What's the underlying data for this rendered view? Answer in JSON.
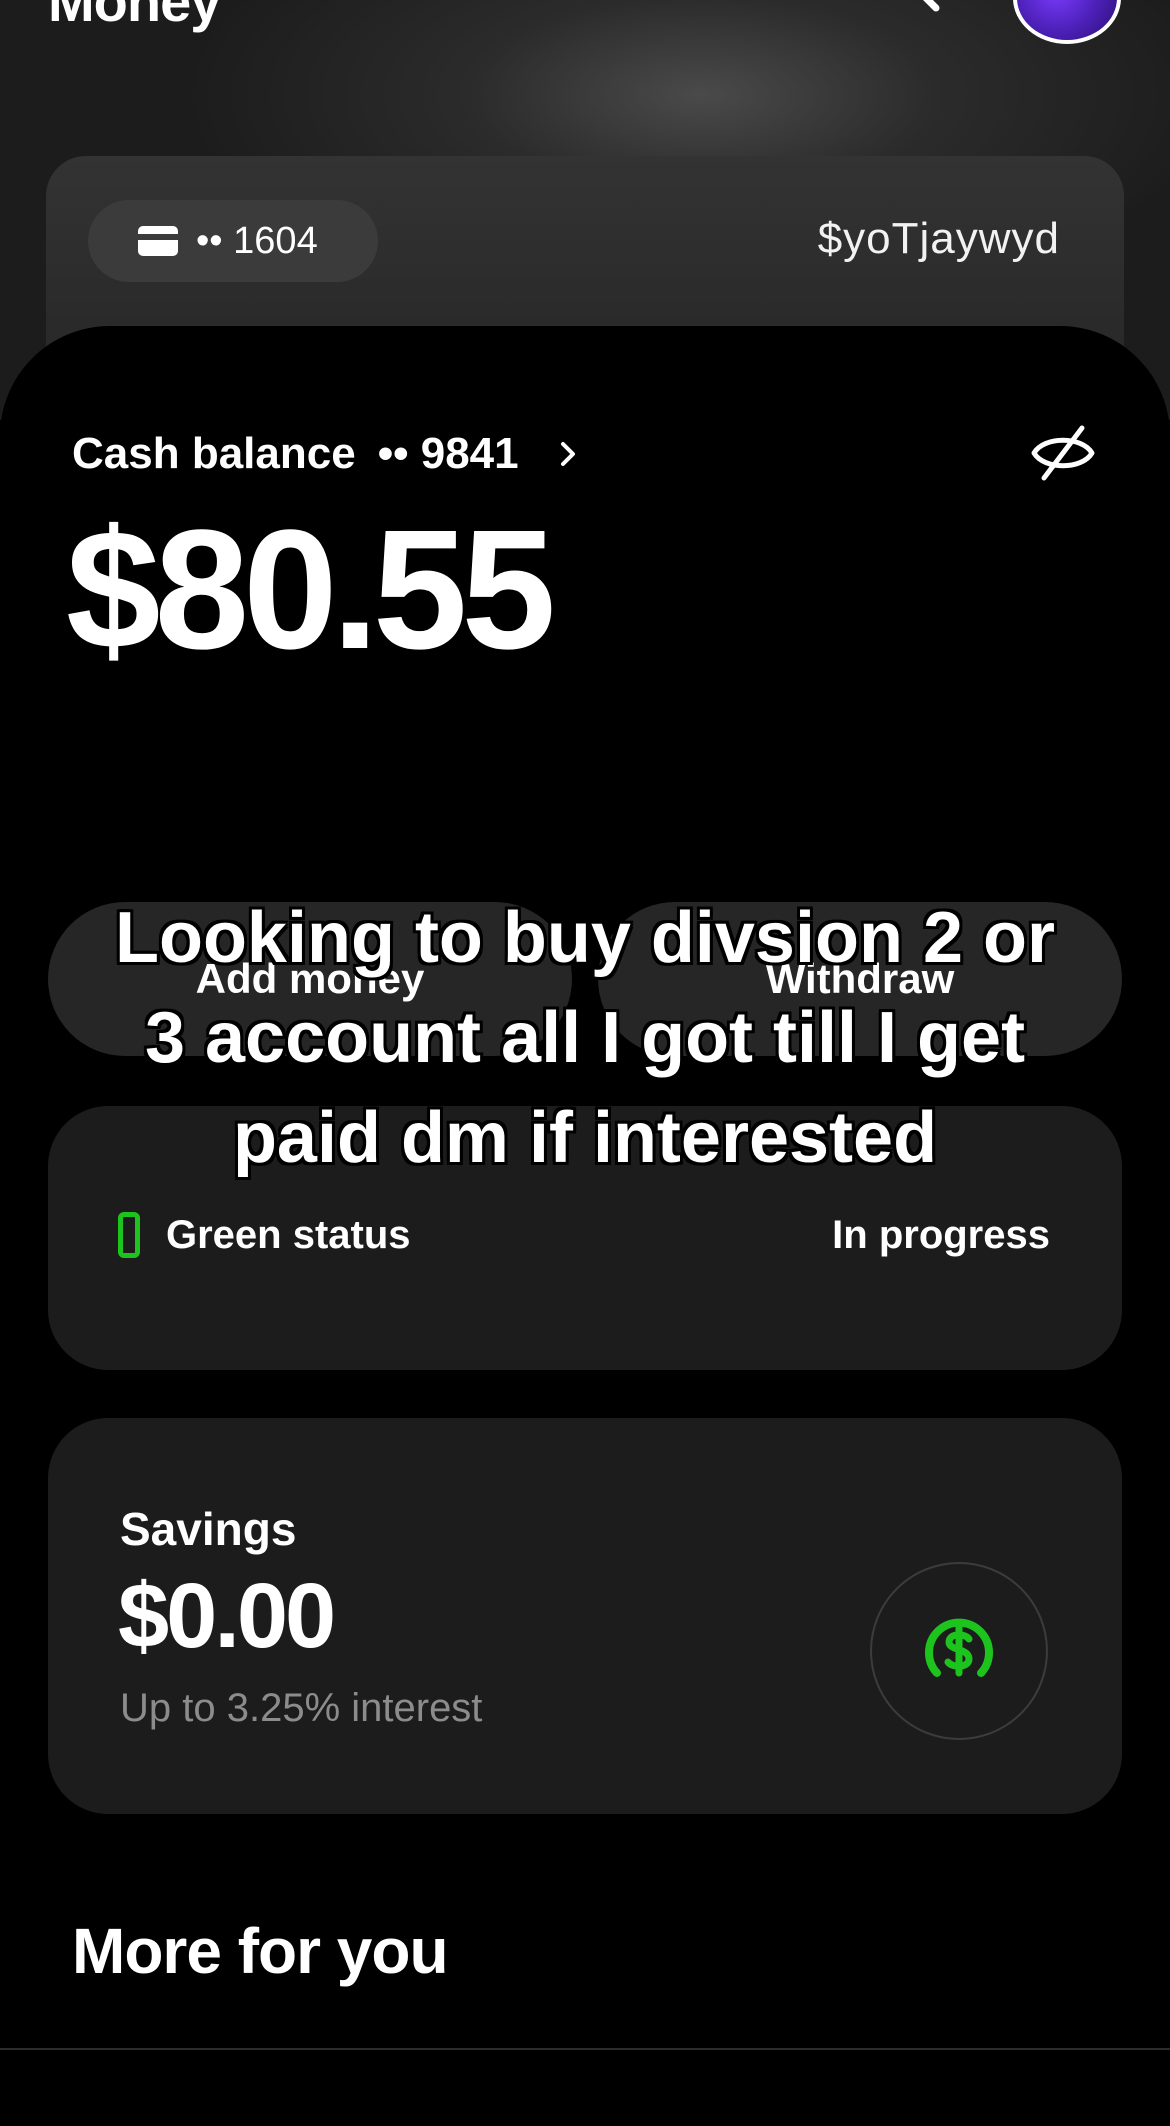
{
  "header": {
    "title": "Money",
    "search_icon": "search-icon",
    "avatar_color": "#6a2fe8"
  },
  "card": {
    "card_icon": "card-icon",
    "last_digits": "•• 1604",
    "cashtag": "$yoTjaywyd"
  },
  "cash": {
    "label": "Cash balance",
    "account": "•• 9841",
    "amount": "$80.55",
    "hide_icon": "eye-off-icon"
  },
  "actions": {
    "add_label": "Add money",
    "withdraw_label": "Withdraw"
  },
  "status": {
    "label": "Green status",
    "value": "In progress",
    "accent": "#1ec41e"
  },
  "savings": {
    "label": "Savings",
    "amount": "$0.00",
    "subtitle": "Up to 3.25% interest",
    "icon": "dollar-circle-icon",
    "accent": "#1ec41e"
  },
  "more": {
    "title": "More for you"
  },
  "overlay": {
    "caption": "Looking to buy divsion 2 or 3 account all I got till I get paid dm if interested"
  }
}
